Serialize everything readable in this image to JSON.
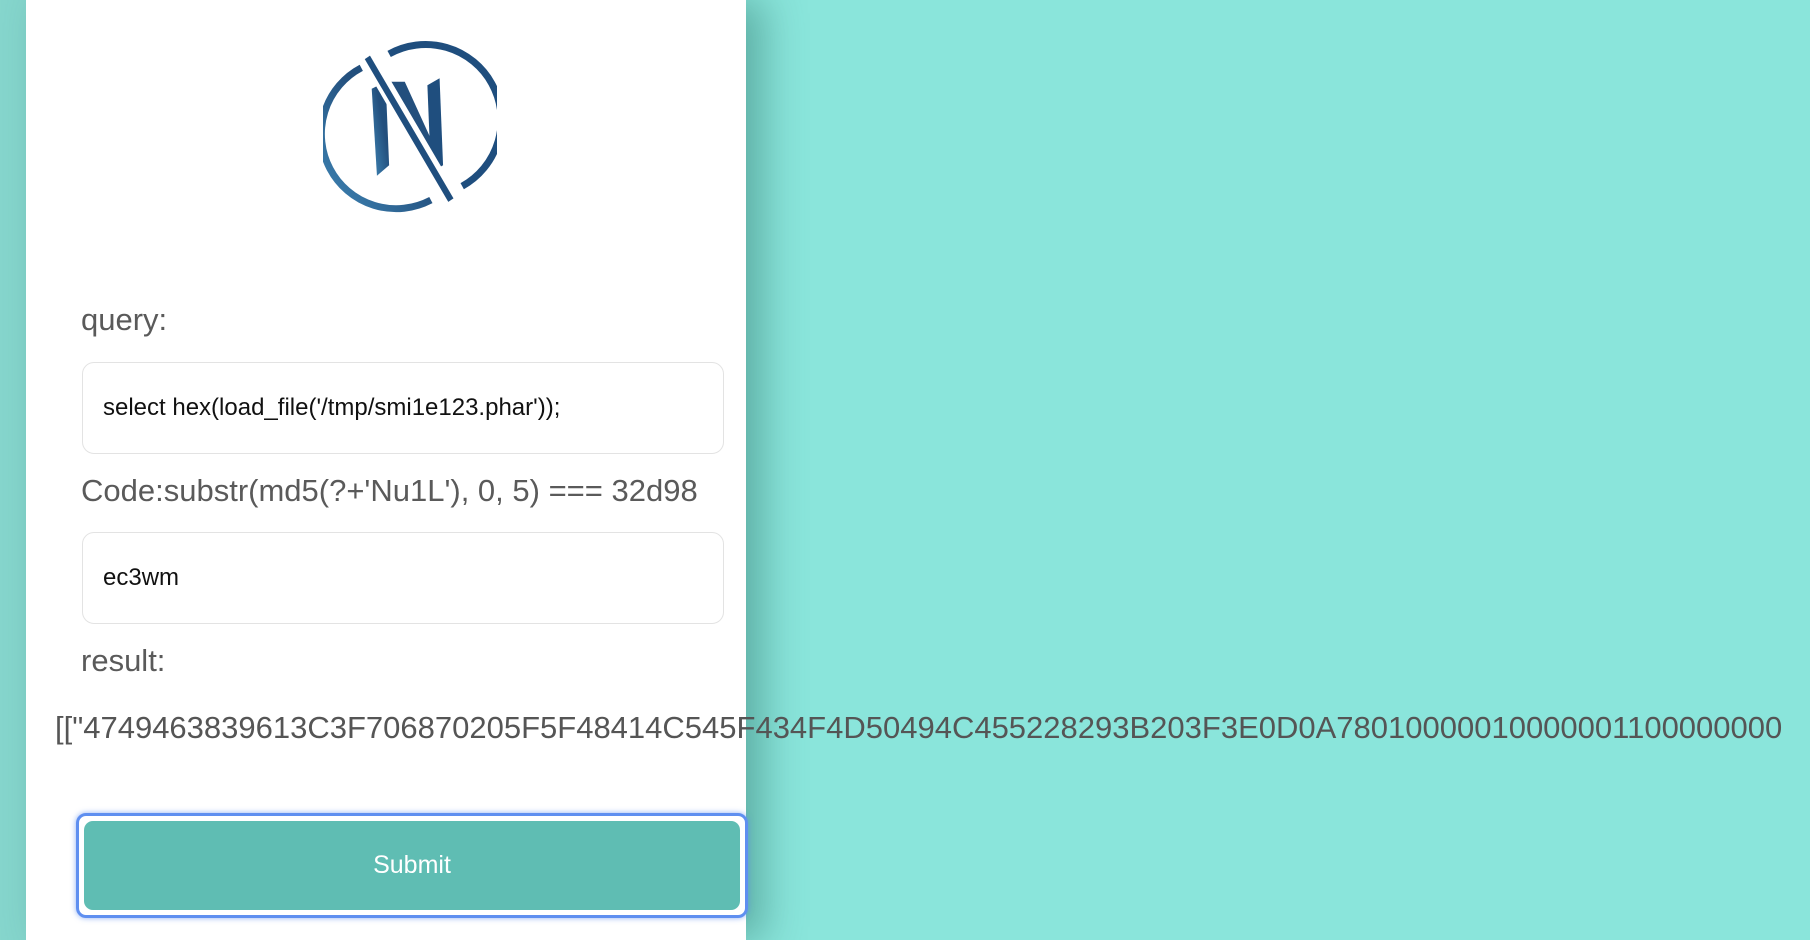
{
  "form": {
    "query_label": "query:",
    "query_value": "select hex(load_file('/tmp/smi1e123.phar'));",
    "code_label": "Code:substr(md5(?+'Nu1L'), 0, 5) === 32d98",
    "code_value": "ec3wm",
    "result_label": "result:",
    "result_value": "[[\"4749463839613C3F706870205F5F48414C545F434F4D50494C455228293B203F3E0D0A78010000010000001100000000",
    "submit_label": "Submit"
  },
  "logo": {
    "icon": "n-circle-logo-icon",
    "primary_color": "#1f4e7e",
    "secondary_color": "#3f86b6"
  },
  "colors": {
    "background": "#8ae5db",
    "submit_button": "#5fbdb3",
    "focus_ring": "#5f8ff0"
  }
}
